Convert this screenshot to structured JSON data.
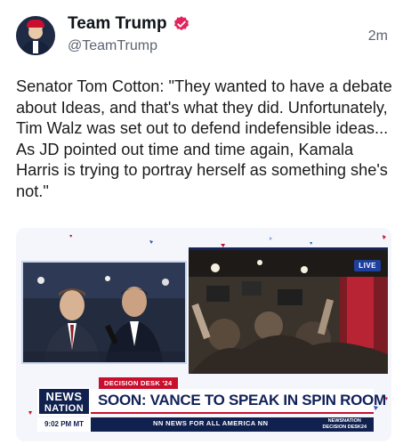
{
  "post": {
    "author_name": "Team Trump",
    "handle": "@TeamTrump",
    "timestamp": "2m",
    "verified_color": "#e0245e",
    "text": "Senator Tom Cotton: \"They wanted to have a debate about Ideas, and that's what they did. Unfortunately, Tim Walz was set out to defend indefensible ideas... As JD pointed out time and time again, Kamala Harris is trying to portray herself as something she's not.\""
  },
  "media": {
    "live_badge": "LIVE",
    "desk_tag": "DECISION DESK '24",
    "logo_line1": "NEWS",
    "logo_line2": "NATION",
    "headline": "SOON: VANCE TO SPEAK IN SPIN ROOM",
    "clock": "9:02 PM MT",
    "tagline": "NN NEWS FOR ALL AMERICA NN",
    "corner_logo_line1": "NEWSNATION",
    "corner_logo_line2": "DECISION DESK24",
    "brand_navy": "#10214f",
    "brand_red": "#c8102e"
  }
}
